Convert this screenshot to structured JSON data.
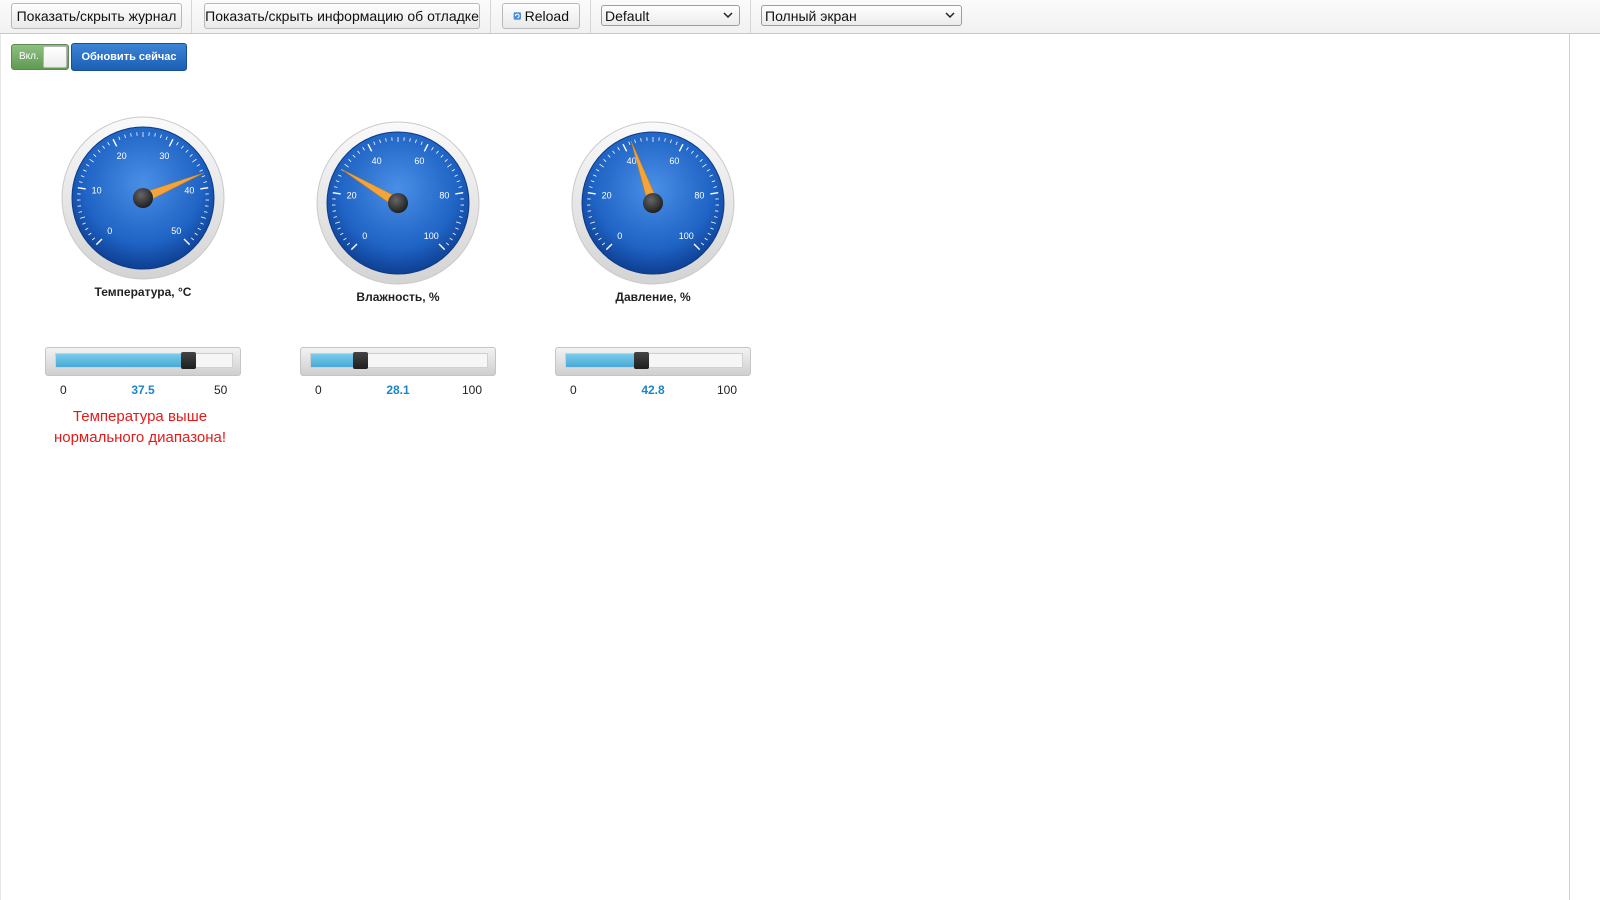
{
  "toolbar": {
    "toggle_log_label": "Показать/скрыть журнал",
    "toggle_debug_label": "Показать/скрыть информацию об отладке",
    "reload_label": "Reload",
    "theme_select_value": "Default",
    "view_select_value": "Полный экран"
  },
  "controls": {
    "switch_label": "Вкл.",
    "refresh_label": "Обновить сейчас"
  },
  "gauges": [
    {
      "id": "temperature",
      "title": "Температура, °C",
      "min": 0,
      "max": 50,
      "value": 37.5,
      "scale_labels": [
        "0",
        "10",
        "20",
        "30",
        "40",
        "50"
      ],
      "min_label": "0",
      "max_label": "50",
      "value_label": "37.5"
    },
    {
      "id": "humidity",
      "title": "Влажность, %",
      "min": 0,
      "max": 100,
      "value": 28.1,
      "scale_labels": [
        "0",
        "20",
        "40",
        "60",
        "80",
        "100"
      ],
      "min_label": "0",
      "max_label": "100",
      "value_label": "28.1"
    },
    {
      "id": "pressure",
      "title": "Давление, %",
      "min": 0,
      "max": 100,
      "value": 42.8,
      "scale_labels": [
        "0",
        "20",
        "40",
        "60",
        "80",
        "100"
      ],
      "min_label": "0",
      "max_label": "100",
      "value_label": "42.8"
    }
  ],
  "warning": {
    "line1": "Температура выше",
    "line2": "нормального диапазона!"
  },
  "colors": {
    "dial_blue": "#1f63c4",
    "needle_orange": "#f4a43a",
    "slider_fill": "#5ab8e0",
    "value_text": "#1a86c8",
    "warning_red": "#e41b1b",
    "refresh_button": "#2a6fc6",
    "switch_green": "#6fa862"
  }
}
